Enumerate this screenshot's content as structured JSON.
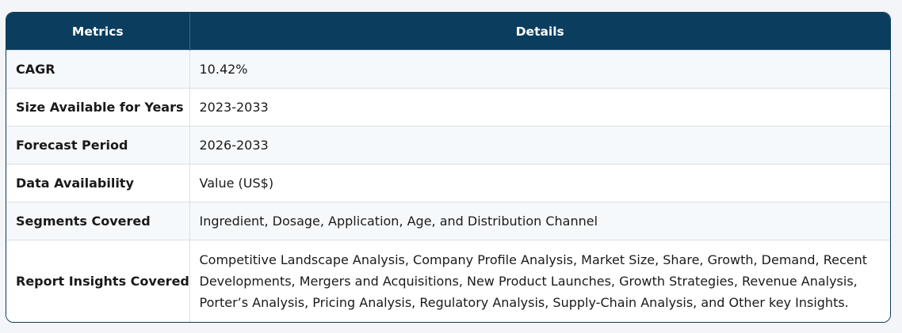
{
  "header": {
    "col1": "Metrics",
    "col2": "Details"
  },
  "rows": [
    {
      "metric": "CAGR",
      "detail": "10.42%"
    },
    {
      "metric": "Size Available for Years",
      "detail": "2023-2033"
    },
    {
      "metric": "Forecast Period",
      "detail": "2026-2033"
    },
    {
      "metric": "Data Availability",
      "detail": "Value (US$)"
    },
    {
      "metric": "Segments Covered",
      "detail": "Ingredient, Dosage, Application, Age, and Distribution Channel"
    },
    {
      "metric": "Report Insights Covered",
      "detail": "Competitive Landscape Analysis, Company Profile Analysis, Market Size, Share, Growth, Demand, Recent Developments, Mergers and Acquisitions, New Product Launches, Growth Strategies, Revenue Analysis, Porter’s Analysis, Pricing Analysis, Regulatory Analysis, Supply-Chain Analysis, and Other key Insights."
    }
  ],
  "colors": {
    "header_bg": "#0b3d5e",
    "header_text": "#ffffff",
    "stripe": "#f6f9fc",
    "border": "#d9dfe6"
  }
}
